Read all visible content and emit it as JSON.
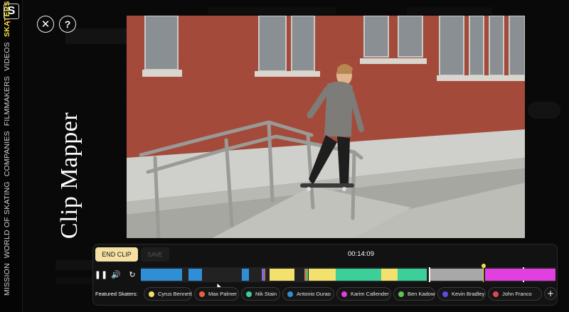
{
  "app": {
    "logo_letter": "S"
  },
  "nav": {
    "items": [
      {
        "label": "MISSION",
        "active": false
      },
      {
        "label": "WORLD OF SKATING",
        "active": false
      },
      {
        "label": "COMPANIES",
        "active": false
      },
      {
        "label": "FILMMAKERS",
        "active": false
      },
      {
        "label": "VIDEOS",
        "active": false
      },
      {
        "label": "SKATERS",
        "active": true
      }
    ]
  },
  "header": {
    "close_icon": "close-icon",
    "help_label": "?",
    "title": "Clip Mapper"
  },
  "video": {
    "description_icon": "video-frame"
  },
  "controls": {
    "end_clip_label": "END CLIP",
    "save_label": "SAVE",
    "timecode": "00:14:09",
    "pause_icon": "pause-icon",
    "volume_icon": "volume-icon",
    "replay_icon": "replay-icon"
  },
  "timeline": {
    "playhead_fraction": 0.825,
    "segments": [
      {
        "skater": "Antonio Durao",
        "color": "#2f8fd6",
        "start": 0.0,
        "end": 0.1
      },
      {
        "skater": "Antonio Durao",
        "color": "#2f8fd6",
        "start": 0.115,
        "end": 0.148
      },
      {
        "skater": "Antonio Durao",
        "color": "#2f8fd6",
        "start": 0.244,
        "end": 0.262
      },
      {
        "skater": "Cyrus Bennett",
        "color": "#f2e16c",
        "start": 0.31,
        "end": 0.37
      },
      {
        "skater": "Cyrus Bennett",
        "color": "#f2e16c",
        "start": 0.405,
        "end": 0.47
      },
      {
        "skater": "Nik Stain",
        "color": "#3dcf9a",
        "start": 0.47,
        "end": 0.58
      },
      {
        "skater": "Cyrus Bennett",
        "color": "#f2e16c",
        "start": 0.58,
        "end": 0.62
      },
      {
        "skater": "Nik Stain",
        "color": "#3dcf9a",
        "start": 0.62,
        "end": 0.69
      },
      {
        "skater": "Karim Callender",
        "color": "#e23fe0",
        "start": 0.83,
        "end": 1.0
      }
    ]
  },
  "featured": {
    "label": "Featured Skaters:",
    "skaters": [
      {
        "name": "Cyrus Bennett",
        "color": "#f2e16c"
      },
      {
        "name": "Max Palmer",
        "color": "#e8613a"
      },
      {
        "name": "Nik Stain",
        "color": "#3dcf9a"
      },
      {
        "name": "Antonio Durao",
        "color": "#2f8fd6"
      },
      {
        "name": "Karim Callender",
        "color": "#e23fe0"
      },
      {
        "name": "Ben Kadow",
        "color": "#62c25a"
      },
      {
        "name": "Kevin Bradley",
        "color": "#5b4ee0"
      },
      {
        "name": "John Franco",
        "color": "#e0484f"
      }
    ],
    "add_label": "+"
  }
}
